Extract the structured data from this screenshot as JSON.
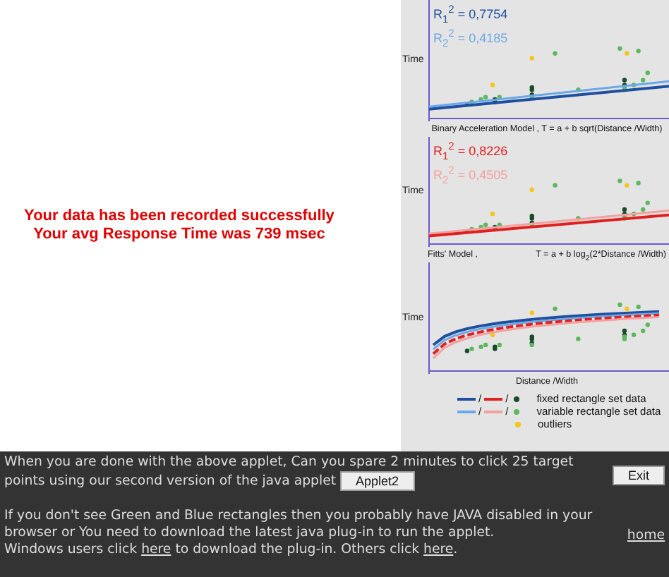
{
  "message": {
    "lines": [
      "Your data has been recorded successfully",
      "Your avg Response Time was 739 msec"
    ]
  },
  "plots": [
    {
      "kind": "linear",
      "y_label": "Time",
      "r_squared": [
        {
          "text": "R$_{1}$$^{2}$ = 0,7754",
          "color": "#1f4f9f"
        },
        {
          "text": "R$_{2}$$^{2}$ = 0,4185",
          "color": "#6aa8e8"
        }
      ],
      "caption": [
        "Binary Acceleration Model ,   T = a + b sqrt(Distance /Width)"
      ]
    },
    {
      "kind": "linear",
      "y_label": "Time",
      "r_squared": [
        {
          "text": "R$_{1}$$^{2}$ = 0,8226",
          "color": "#e02020"
        },
        {
          "text": "R$_{2}$$^{2}$ = 0,4505",
          "color": "#f4a0a0"
        }
      ],
      "caption": [
        "Fitts' Model ,",
        "T = a + b log$_{2}$(2*Distance /Width)"
      ]
    },
    {
      "kind": "log",
      "y_label": "Time",
      "caption": [
        "Distance /Width"
      ]
    }
  ],
  "legend": [
    {
      "kind": "lines",
      "swatches": [
        {
          "color": "#1f4f9f"
        },
        {
          "color": "#e02020"
        }
      ],
      "dot": {
        "color": "#1a4a2a"
      },
      "separator": "/",
      "label": "fixed rectangle set data"
    },
    {
      "kind": "lines",
      "swatches": [
        {
          "color": "#6aa8e8"
        },
        {
          "color": "#f4a0a0"
        }
      ],
      "dot": {
        "color": "#5cb85c"
      },
      "separator": "/",
      "label": "variable rectangle set data"
    },
    {
      "kind": "dot",
      "dot": {
        "color": "#f5c518"
      },
      "label": "outliers"
    }
  ],
  "footer": {
    "paragraph_1": "When you are done with the above applet, Can you spare 2 minutes to click 25 target points using our second version of the java applet",
    "applet_button": "Applet2",
    "exit_button": "Exit",
    "paragraph_2": "If you don't see Green and Blue rectangles then you probably have JAVA disabled in your browser or You need to download the latest java plug-in to run the applet.",
    "line_3_parts": [
      "Windows users click ",
      "here",
      " to download the plug-in. Others click ",
      "here",
      "."
    ],
    "home_link": "home"
  }
}
